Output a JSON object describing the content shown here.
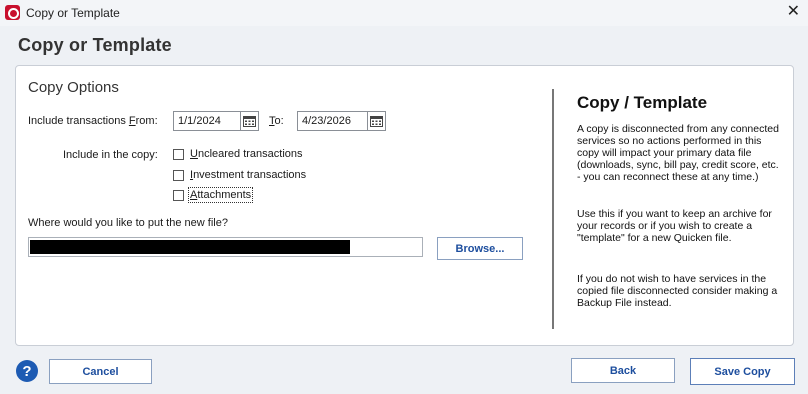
{
  "window": {
    "title": "Copy or Template",
    "close_glyph": "✕"
  },
  "dialog": {
    "heading": "Copy or Template"
  },
  "copy_options": {
    "section_title": "Copy Options",
    "from_label_pre": "Include transactions ",
    "from_label_key": "F",
    "from_label_post": "rom:",
    "from_date": "1/1/2024",
    "to_label_key": "T",
    "to_label_post": "o:",
    "to_date": "4/23/2026",
    "include_label": "Include in the copy:",
    "checkboxes": [
      {
        "key": "U",
        "rest": "ncleared transactions",
        "checked": false
      },
      {
        "key": "I",
        "rest": "nvestment transactions",
        "checked": false
      },
      {
        "key": "A",
        "rest": "ttachments",
        "checked": false
      }
    ],
    "location_label": "Where would you like to put the new file?",
    "path_value": "",
    "browse_label": "Browse..."
  },
  "sidebar": {
    "title": "Copy / Template",
    "paragraphs": [
      "A copy is disconnected from any connected services so no actions performed in this copy will impact your primary data file (downloads, sync, bill pay, credit score, etc. - you can reconnect these at any time.)",
      "Use this if you want to keep an archive for your records or if you wish to create a \"template\" for a new Quicken file.",
      "If you do not wish to have services in the copied file disconnected consider making a Backup File instead."
    ]
  },
  "footer": {
    "help_glyph": "?",
    "cancel_label": "Cancel",
    "back_label": "Back",
    "save_label": "Save Copy"
  },
  "colors": {
    "brand": "#c8102e",
    "link_blue": "#1d4e9e",
    "help_blue": "#1d5bb3"
  },
  "icons": [
    "quicken-logo-icon",
    "close-icon",
    "calendar-icon",
    "help-icon"
  ]
}
